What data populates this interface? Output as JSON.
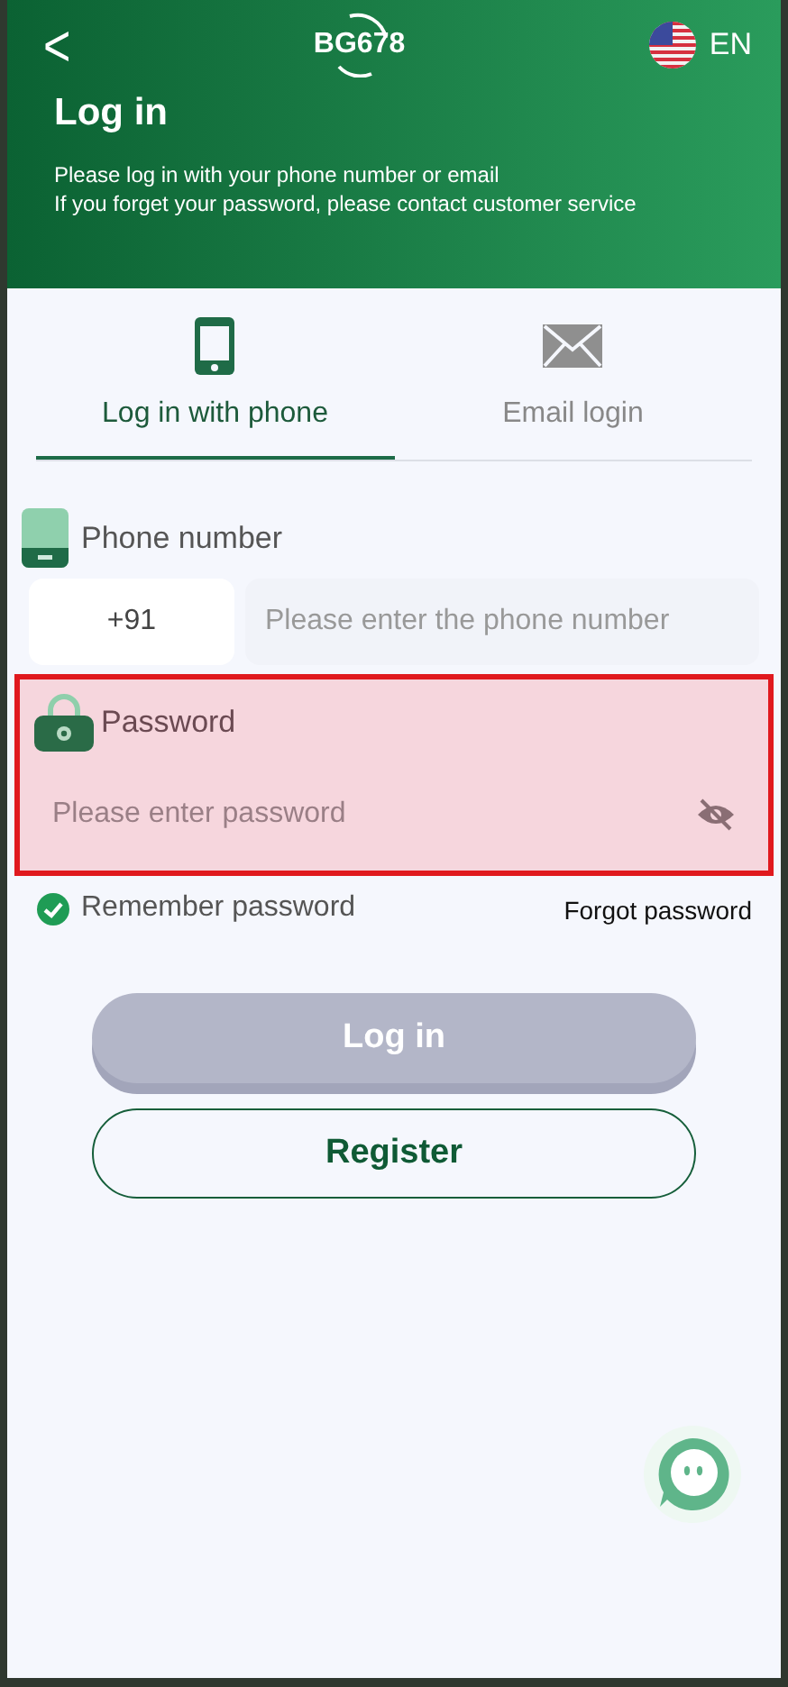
{
  "header": {
    "back": "<",
    "logo": "BG678",
    "language": "EN",
    "title": "Log in",
    "subtitle_lines": [
      "Please log in with your phone number or email",
      "If you forget your password, please contact customer service"
    ]
  },
  "tabs": [
    {
      "label": "Log in with phone",
      "kind": "phone",
      "selected": true
    },
    {
      "label": "Email login",
      "kind": "email",
      "selected": false
    }
  ],
  "phone": {
    "label": "Phone number",
    "country_code": "+91",
    "placeholder": "Please enter the phone number"
  },
  "password": {
    "label": "Password",
    "placeholder": "Please enter password",
    "highlighted": true,
    "visible": false
  },
  "remember": {
    "label": "Remember password",
    "checked": true
  },
  "forgot": "Forgot password",
  "buttons": [
    {
      "label": "Log in",
      "kind": "primary",
      "disabled": true
    },
    {
      "label": "Register",
      "kind": "outline",
      "disabled": false
    }
  ]
}
